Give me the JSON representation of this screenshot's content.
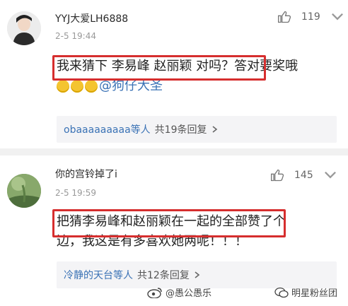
{
  "comments": [
    {
      "username": "YYJ大爱LH6888",
      "timestamp": "2-5 19:44",
      "likes": "119",
      "text_line1": "我来猜下 李易峰 赵丽颖 对吗？答对要奖哦",
      "mention": "@狗仔大圣",
      "replies": {
        "who": "obaaaaaaaaa等人",
        "count_text": "共19条回复"
      }
    },
    {
      "username": "你的宫铃掉了i",
      "timestamp": "2-5 19:59",
      "likes": "145",
      "text_line1": "把猜李易峰和赵丽颖在一起的全部赞了个",
      "text_line2": "边，我这是有多喜欢她两呢！！！",
      "replies": {
        "who": "冷静的天台等人",
        "count_text": "共12条回复"
      }
    }
  ],
  "watermarks": {
    "weibo": "@愚公愚乐",
    "wechat": "明星粉丝团"
  },
  "colors": {
    "highlight": "#d62e2e",
    "link": "#3a72b5"
  }
}
